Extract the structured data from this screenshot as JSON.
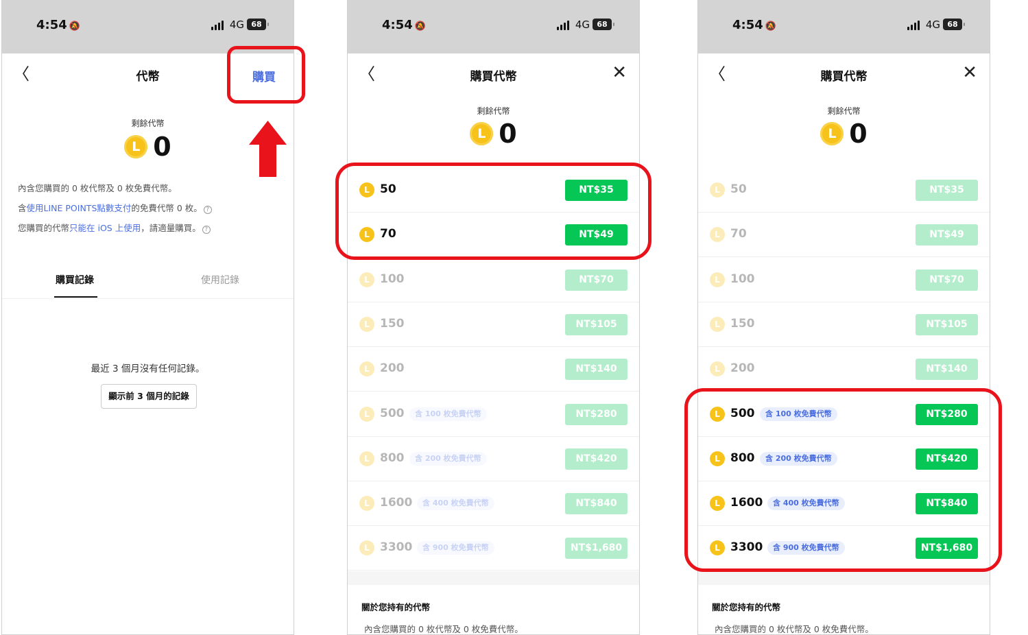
{
  "status_bar": {
    "time": "4:54",
    "network": "4G",
    "battery": "68"
  },
  "p1": {
    "title": "代幣",
    "buy_label": "購買",
    "remaining_label": "剩餘代幣",
    "coin_glyph": "L",
    "balance": "0",
    "info_1": "內含您購買的 0 枚代幣及 0 枚免費代幣。",
    "info_2_pre": "含",
    "info_2_link": "使用LINE POINTS點數支付",
    "info_2_post": "的免費代幣 0 枚。",
    "info_3_pre": "您購買的代幣",
    "info_3_link": "只能在 iOS 上使用",
    "info_3_post": "，請適量購買。",
    "help_glyph": "?",
    "tab_purchase": "購買記錄",
    "tab_usage": "使用記錄",
    "empty_text": "最近 3 個月沒有任何記錄。",
    "prev_button": "顯示前 3 個月的記錄"
  },
  "shop": {
    "title": "購買代幣",
    "remaining_label": "剩餘代幣",
    "coin_glyph": "L",
    "balance": "0",
    "packages": [
      {
        "amount": "50",
        "price": "NT$35",
        "bonus": ""
      },
      {
        "amount": "70",
        "price": "NT$49",
        "bonus": ""
      },
      {
        "amount": "100",
        "price": "NT$70",
        "bonus": ""
      },
      {
        "amount": "150",
        "price": "NT$105",
        "bonus": ""
      },
      {
        "amount": "200",
        "price": "NT$140",
        "bonus": ""
      },
      {
        "amount": "500",
        "price": "NT$280",
        "bonus": "含 100 枚免費代幣"
      },
      {
        "amount": "800",
        "price": "NT$420",
        "bonus": "含 200 枚免費代幣"
      },
      {
        "amount": "1600",
        "price": "NT$840",
        "bonus": "含 400 枚免費代幣"
      },
      {
        "amount": "3300",
        "price": "NT$1,680",
        "bonus": "含 900 枚免費代幣"
      }
    ],
    "about_title": "關於您持有的代幣",
    "about_text": "內含您購買的 0 枚代幣及 0 枚免費代幣。"
  },
  "colors": {
    "accent_green": "#06c755",
    "link_blue": "#4a6ee0",
    "coin_gold": "#f7c31b",
    "highlight_red": "#e8131b"
  }
}
